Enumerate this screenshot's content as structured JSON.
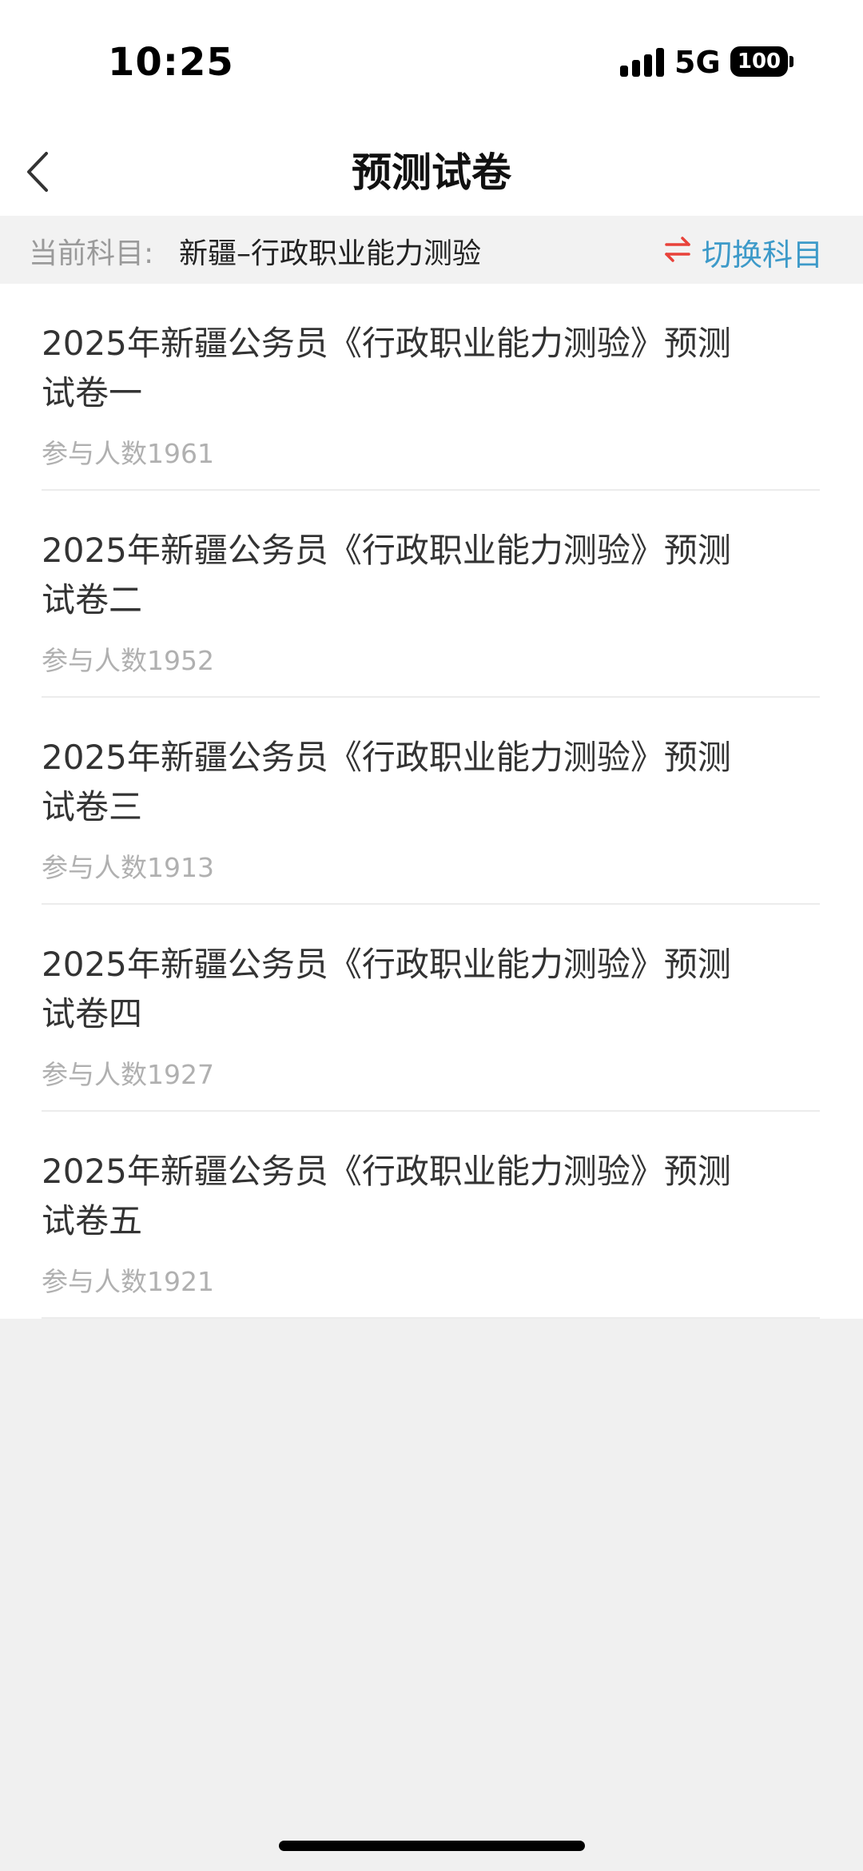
{
  "status_bar": {
    "time": "10:25",
    "network": "5G",
    "battery": "100"
  },
  "nav": {
    "title": "预测试卷",
    "back_icon": "chevron-left-icon"
  },
  "subject": {
    "label": "当前科目:",
    "value": "新疆–行政职业能力测验",
    "switch_label": "切换科目",
    "switch_icon": "swap-arrows-icon",
    "switch_icon_color": "#e8423a",
    "switch_text_color": "#3d9ac9"
  },
  "papers": [
    {
      "title": "2025年新疆公务员《行政职业能力测验》预测试卷一",
      "count": "参与人数1961"
    },
    {
      "title": "2025年新疆公务员《行政职业能力测验》预测试卷二",
      "count": "参与人数1952"
    },
    {
      "title": "2025年新疆公务员《行政职业能力测验》预测试卷三",
      "count": "参与人数1913"
    },
    {
      "title": "2025年新疆公务员《行政职业能力测验》预测试卷四",
      "count": "参与人数1927"
    },
    {
      "title": "2025年新疆公务员《行政职业能力测验》预测试卷五",
      "count": "参与人数1921"
    }
  ]
}
